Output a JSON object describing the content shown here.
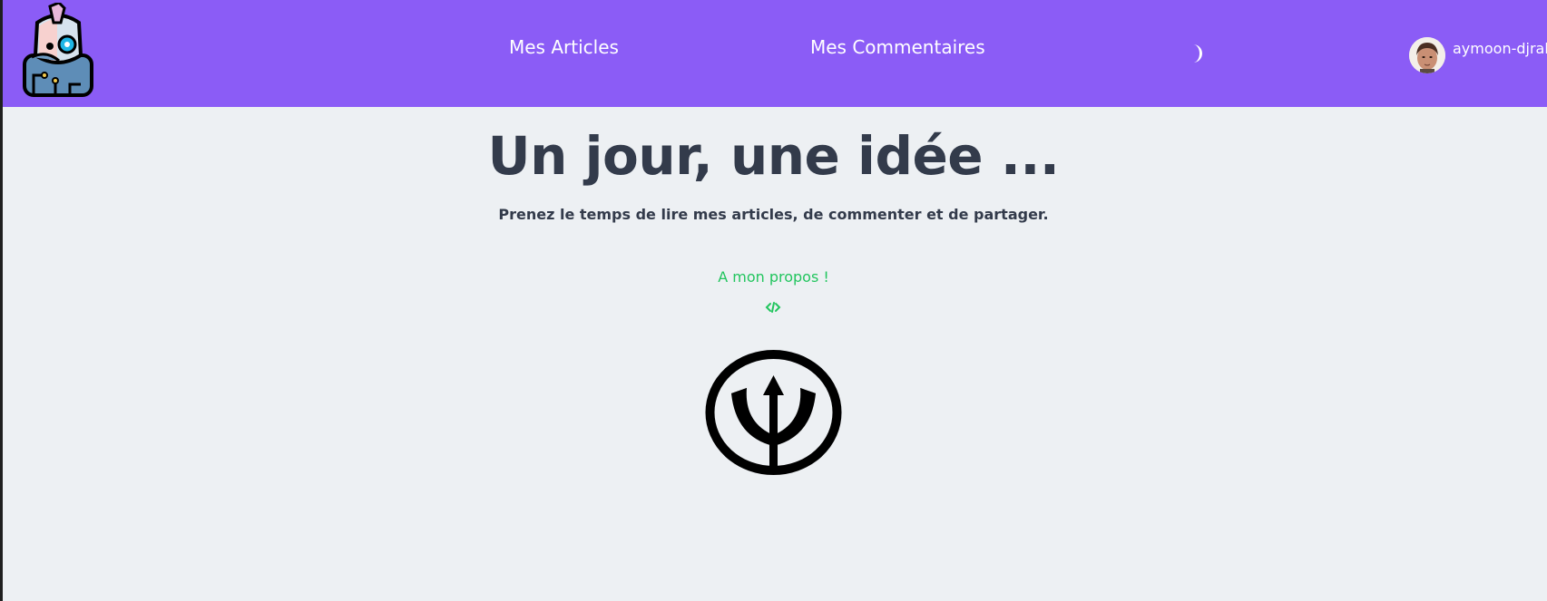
{
  "navbar": {
    "background": "#8b5cf6",
    "logo_icon": "cyborg-robot-icon",
    "links": [
      {
        "label": "Mes Articles"
      },
      {
        "label": "Mes Commentaires"
      }
    ],
    "theme_toggle_icon": "moon-icon",
    "user": {
      "avatar_icon": "user-avatar",
      "username": "aymoon-djrak"
    }
  },
  "hero": {
    "title": "Un jour, une idée ...",
    "subtitle": "Prenez le temps de lire mes articles, de commenter et de partager.",
    "about_link": "A mon propos !",
    "code_icon": "code-icon",
    "emblem_icon": "trident-icon",
    "accent_color": "#22c55e"
  }
}
